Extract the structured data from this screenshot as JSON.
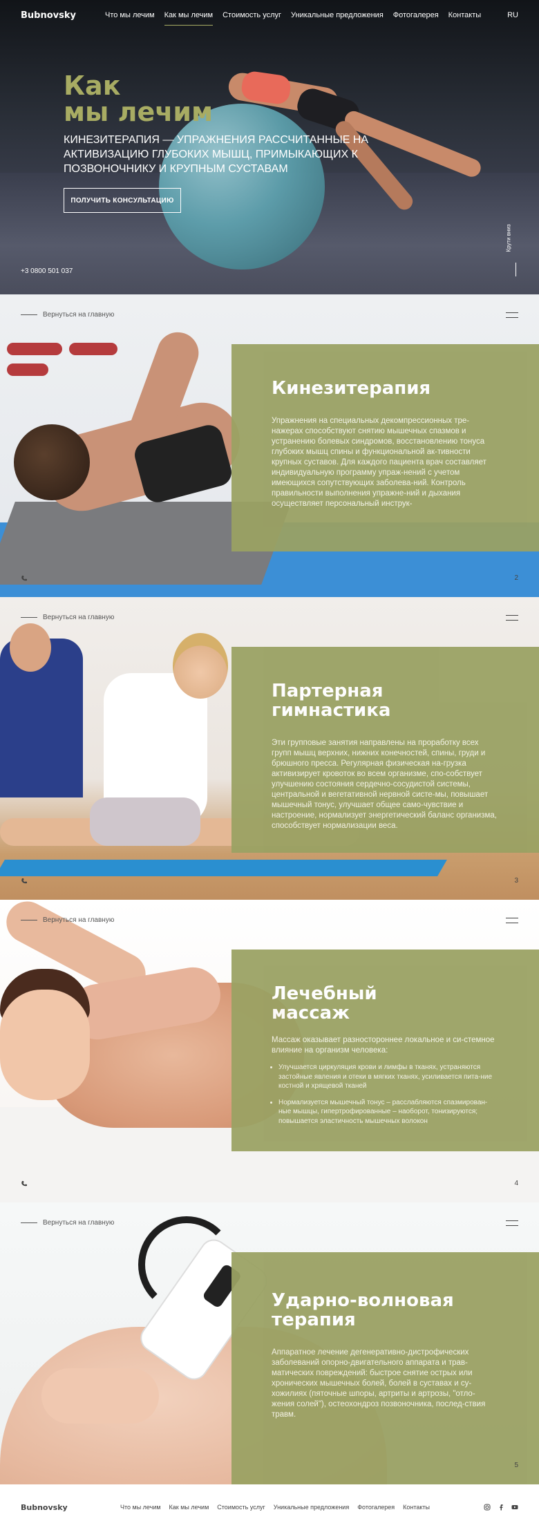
{
  "header": {
    "logo": "Bubnovsky",
    "menu": [
      "Что мы лечим",
      "Как мы лечим",
      "Стоимость услуг",
      "Уникальные предложения",
      "Фотогалерея",
      "Контакты"
    ],
    "active_index": 1,
    "lang": "RU"
  },
  "hero": {
    "title_line1": "Как",
    "title_line2": "мы лечим",
    "subtitle": "КИНЕЗИТЕРАПИЯ — УПРАЖНЕНИЯ РАССЧИТАННЫЕ НА АКТИВИЗАЦИЮ ГЛУБОКИХ МЫШЦ, ПРИМЫКАЮЩИХ К ПОЗВОНОЧНИКУ И КРУПНЫМ СУСТАВАМ",
    "button": "ПОЛУЧИТЬ КОНСУЛЬТАЦИЮ",
    "phone": "+3 0800 501 037",
    "scroll_label": "Крути вниз"
  },
  "common": {
    "back_label": "Вернуться на главную"
  },
  "sections": [
    {
      "number": "2",
      "title": "Кинезитерапия",
      "text": "Упражнения на специальных декомпрессионных тре-нажерах способствуют снятию мышечных спазмов и устранению болевых синдромов, восстановлению тонуса глубоких мышц спины и функциональной ак-тивности крупных суставов. Для каждого пациента врач составляет индивидуальную программу упраж-нений с учетом имеющихся сопутствующих заболева-ний. Контроль правильности выполнения упражне-ний и дыхания осуществляет персональный инструк-"
    },
    {
      "number": "3",
      "title_line1": "Партерная",
      "title_line2": "гимнастика",
      "text": "Эти групповые занятия направлены на проработку всех групп мышц верхних, нижних конечностей, спины, груди и брюшного пресса. Регулярная физическая на-грузка активизирует кровоток во всем организме, спо-собствует улучшению состояния сердечно-сосудистой системы, центральной и вегетативной нервной систе-мы, повышает мышечный тонус, улучшает общее само-чувствие и настроение, нормализует энергетический баланс организма, способствует нормализации веса."
    },
    {
      "number": "4",
      "title_line1": "Лечебный",
      "title_line2": "массаж",
      "text": "Массаж оказывает разностороннее локальное и си-стемное влияние на организм человека:",
      "bullets": [
        "Улучшается циркуляция крови и лимфы в тканях, устраняются застойные явления и отеки в мягких тканях, усиливается пита-ние костной и хрящевой тканей",
        "Нормализуется мышечный тонус – расслабляются спазмирован-ные мышцы, гипертрофированные – наоборот, тонизируются; повышается эластичность мышечных волокон"
      ]
    },
    {
      "number": "5",
      "title_line1": "Ударно-волновая",
      "title_line2": "терапия",
      "text": "Аппаратное лечение дегенеративно-дистрофических заболеваний опорно-двигательного аппарата и трав-матических повреждений: быстрое снятие острых или хронических мышечных болей, болей в суставах и су-хожилиях (пяточные шпоры, артриты и артрозы, \"отло-жения солей\"), остеохондроз позвоночника, послед-ствия травм."
    }
  ],
  "footer": {
    "logo": "Bubnovsky",
    "menu": [
      "Что мы лечим",
      "Как мы лечим",
      "Стоимость услуг",
      "Уникальные предложения",
      "Фотогалерея",
      "Контакты"
    ],
    "social": [
      "instagram-icon",
      "facebook-icon",
      "youtube-icon"
    ]
  },
  "colors": {
    "accent": "#a8ac63",
    "panel": "#9aa163"
  }
}
